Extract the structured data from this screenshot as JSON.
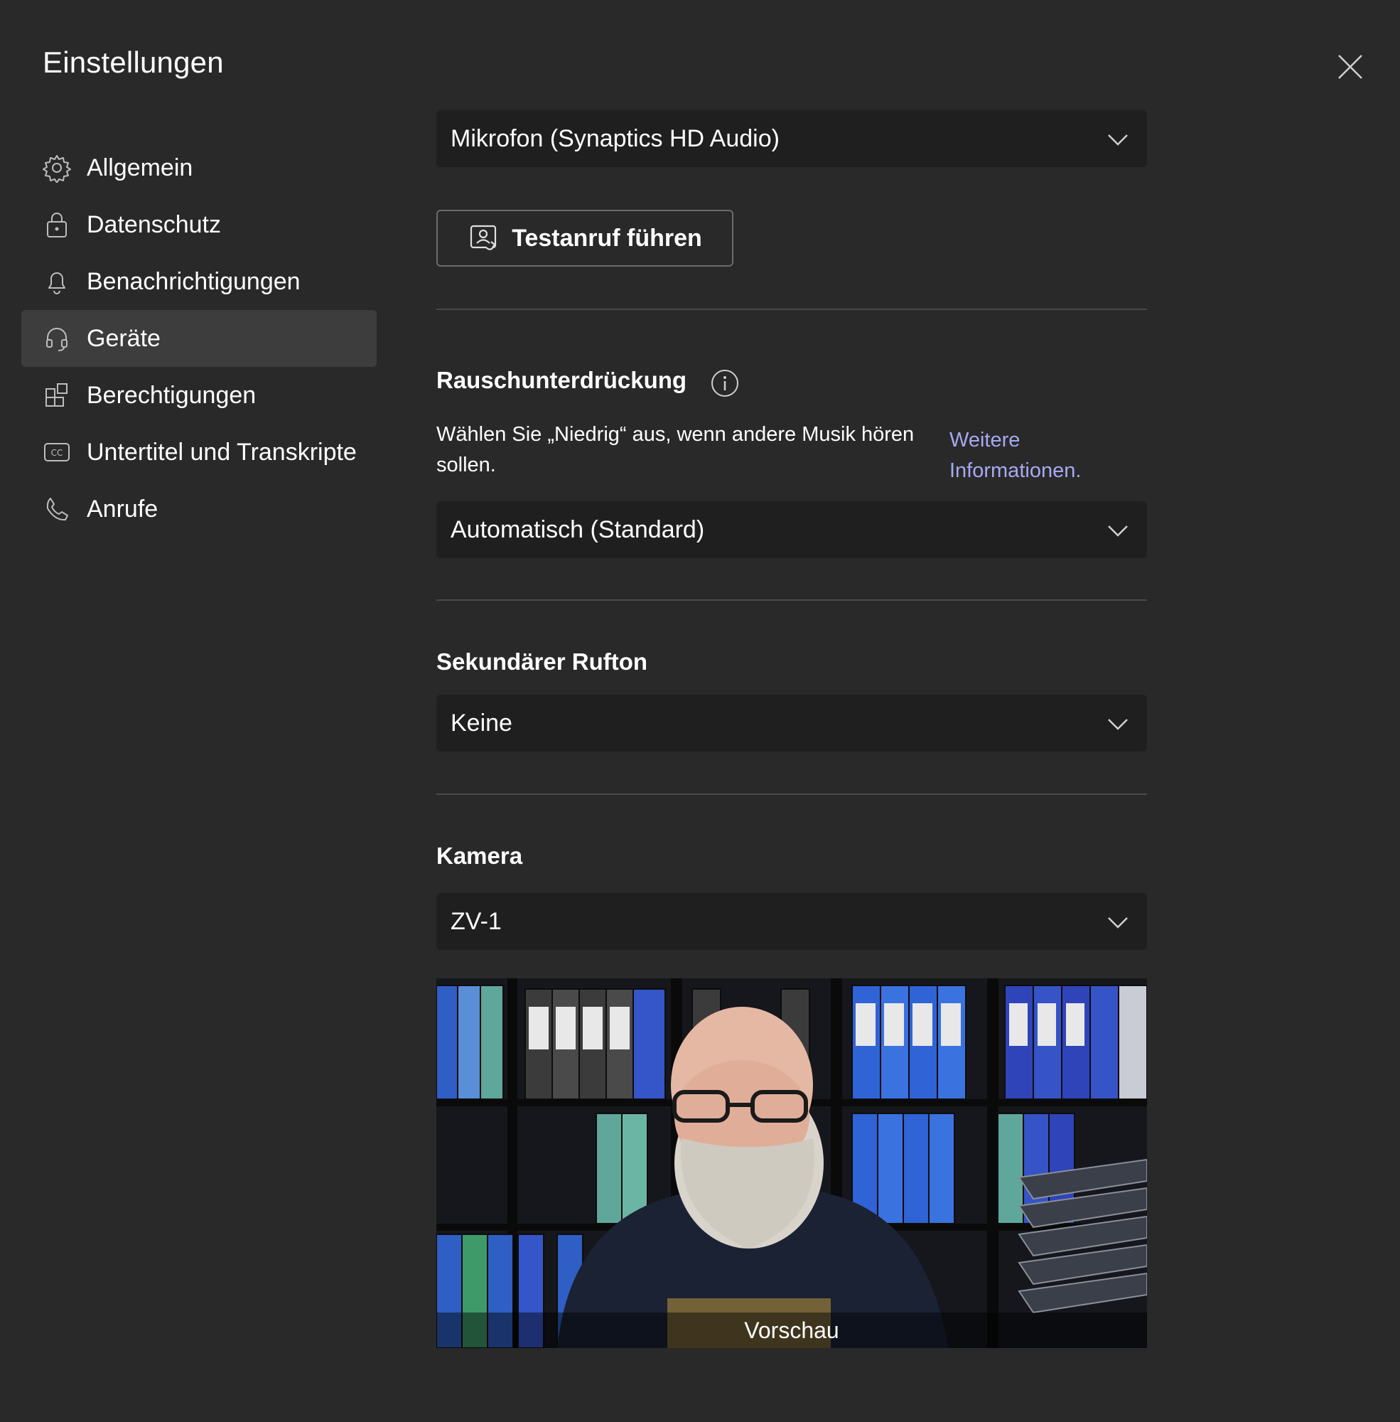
{
  "dialog": {
    "title": "Einstellungen",
    "close_icon": "close-icon"
  },
  "sidebar": {
    "items": [
      {
        "label": "Allgemein",
        "icon": "gear-icon"
      },
      {
        "label": "Datenschutz",
        "icon": "lock-icon"
      },
      {
        "label": "Benachrichtigungen",
        "icon": "bell-icon"
      },
      {
        "label": "Geräte",
        "icon": "headset-icon",
        "active": true
      },
      {
        "label": "Berechtigungen",
        "icon": "apps-icon"
      },
      {
        "label": "Untertitel und Transkripte",
        "icon": "cc-icon"
      },
      {
        "label": "Anrufe",
        "icon": "phone-icon"
      }
    ]
  },
  "microphone": {
    "selected": "Mikrofon (Synaptics HD Audio)"
  },
  "test_call": {
    "label": "Testanruf führen"
  },
  "noise": {
    "heading": "Rauschunterdrückung",
    "description": "Wählen Sie „Niedrig“ aus, wenn andere Musik hören sollen.",
    "link": "Weitere Informationen.",
    "selected": "Automatisch (Standard)"
  },
  "secondary_ringer": {
    "heading": "Sekundärer Rufton",
    "selected": "Keine"
  },
  "camera": {
    "heading": "Kamera",
    "selected": "ZV-1",
    "preview_label": "Vorschau"
  },
  "colors": {
    "background": "#292929",
    "select_bg": "#1f1f1f",
    "active_nav": "#3d3d3d",
    "link": "#a7a9f2"
  }
}
